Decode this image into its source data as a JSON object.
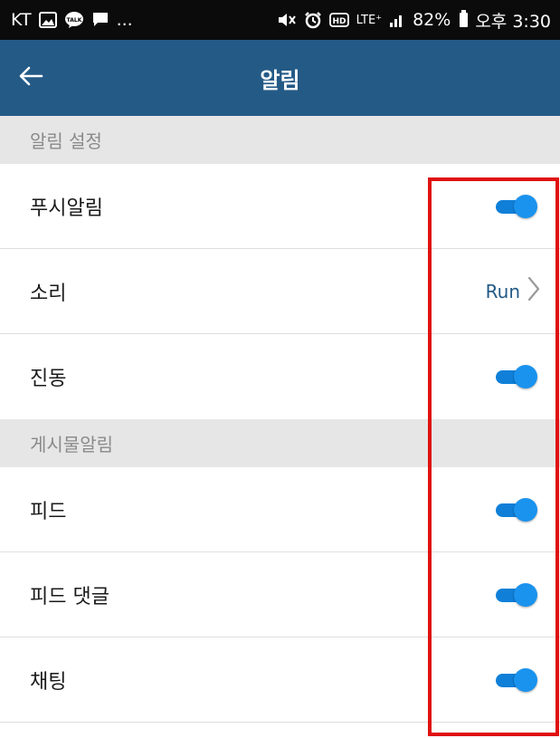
{
  "status_bar": {
    "carrier": "KT",
    "left_icons": [
      "gallery-icon",
      "kakaotalk-icon",
      "chat-icon"
    ],
    "more_indicator": "...",
    "right_icons": [
      "mute-icon",
      "alarm-icon",
      "hd-icon",
      "lte-icon",
      "signal-icon"
    ],
    "lte_label": "LTE⁺",
    "battery_percent": "82%",
    "time": "오후 3:30"
  },
  "app_bar": {
    "title": "알림",
    "back_icon": "back-arrow-icon"
  },
  "sections": [
    {
      "header": "알림 설정",
      "rows": [
        {
          "label": "푸시알림",
          "control": "toggle",
          "on": true
        },
        {
          "label": "소리",
          "control": "link",
          "value": "Run"
        },
        {
          "label": "진동",
          "control": "toggle",
          "on": true
        }
      ]
    },
    {
      "header": "게시물알림",
      "rows": [
        {
          "label": "피드",
          "control": "toggle",
          "on": true
        },
        {
          "label": "피드 댓글",
          "control": "toggle",
          "on": true
        },
        {
          "label": "채팅",
          "control": "toggle",
          "on": true
        }
      ]
    }
  ],
  "colors": {
    "app_bar": "#245a86",
    "toggle_on": "#1a93ee",
    "highlight": "#e01010",
    "section_bg": "#e6e6e6"
  }
}
